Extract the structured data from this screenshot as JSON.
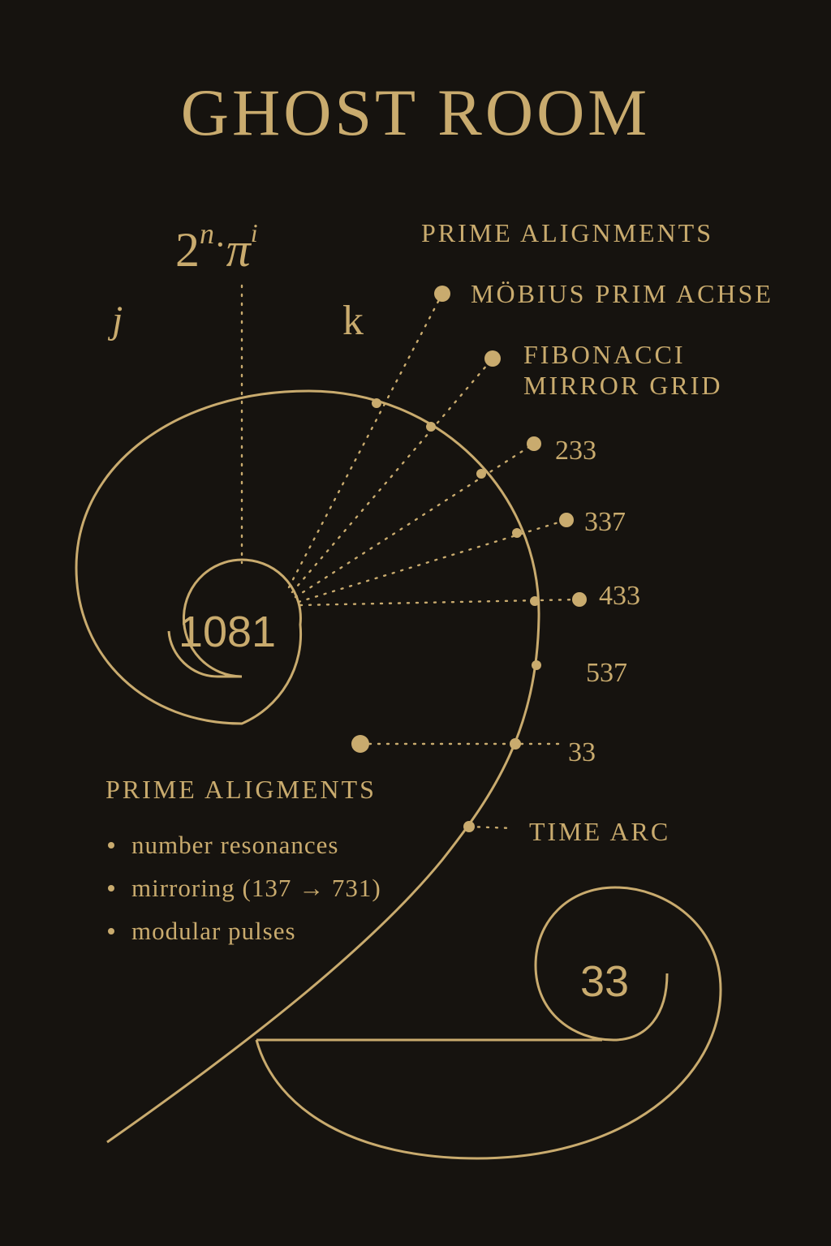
{
  "title": "GHOST ROOM",
  "formula": {
    "base": "2",
    "exp_n": "n",
    "dot": "·",
    "pi": "π",
    "exp_i": "i"
  },
  "axes": {
    "j": "j",
    "k": "k"
  },
  "center_value": "1081",
  "inner_value": "33",
  "right_header": "PRIME ALIGNMENTS",
  "labels": {
    "mobius": "MÖBIUS PRIM ACHSE",
    "fibonacci_line1": "FIBONACCI",
    "fibonacci_line2": "MIRROR GRID",
    "n233": "233",
    "n337": "337",
    "n433": "433",
    "n537": "537",
    "n33": "33",
    "time_arc": "TIME ARC"
  },
  "left_section": {
    "heading": "PRIME ALIGMENTS",
    "items": [
      "number resonances",
      "mirroring (137 → 731)",
      "modular pulses"
    ]
  },
  "colors": {
    "background": "#16130f",
    "gold": "#c9ab6e"
  }
}
